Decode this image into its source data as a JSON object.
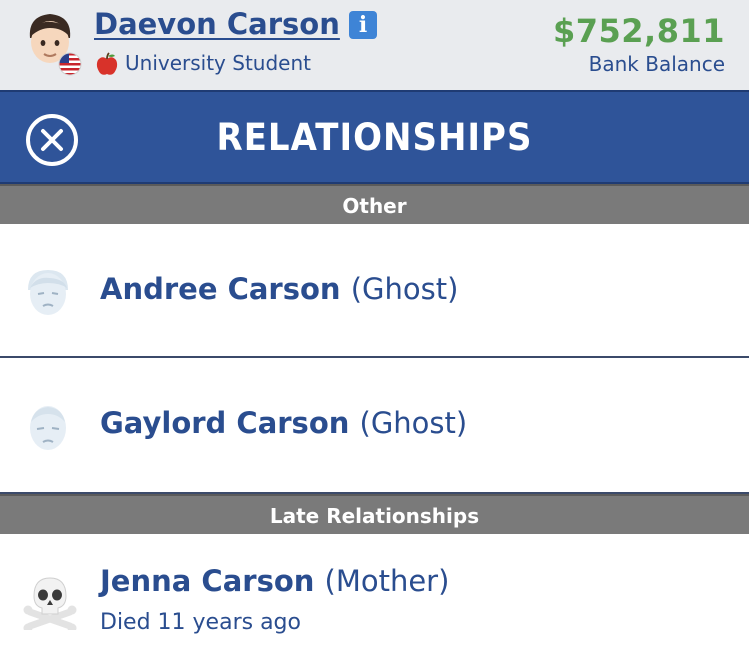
{
  "header": {
    "name": "Daevon Carson",
    "occupation": "University Student",
    "balance": "$752,811",
    "balance_label": "Bank Balance",
    "avatar_icon": "person-emoji-icon",
    "flag_icon": "us-flag-icon",
    "occupation_icon": "apple-icon",
    "info_icon": "info-icon"
  },
  "titlebar": {
    "title": "RELATIONSHIPS",
    "close_icon": "close-icon"
  },
  "sections": {
    "other": "Other",
    "late": "Late Relationships"
  },
  "relationships": [
    {
      "name": "Andree Carson",
      "relation": "(Ghost)",
      "icon": "ghost-face-icon"
    },
    {
      "name": "Gaylord Carson",
      "relation": "(Ghost)",
      "icon": "ghost-face-icon"
    }
  ],
  "late_relationships": [
    {
      "name": "Jenna Carson",
      "relation": "(Mother)",
      "detail": "Died 11 years ago",
      "icon": "skull-crossbones-icon"
    }
  ],
  "colors": {
    "primary_blue": "#2f5499",
    "text_blue": "#2a4d8f",
    "money_green": "#5aa052",
    "section_gray": "#7a7a7a"
  }
}
